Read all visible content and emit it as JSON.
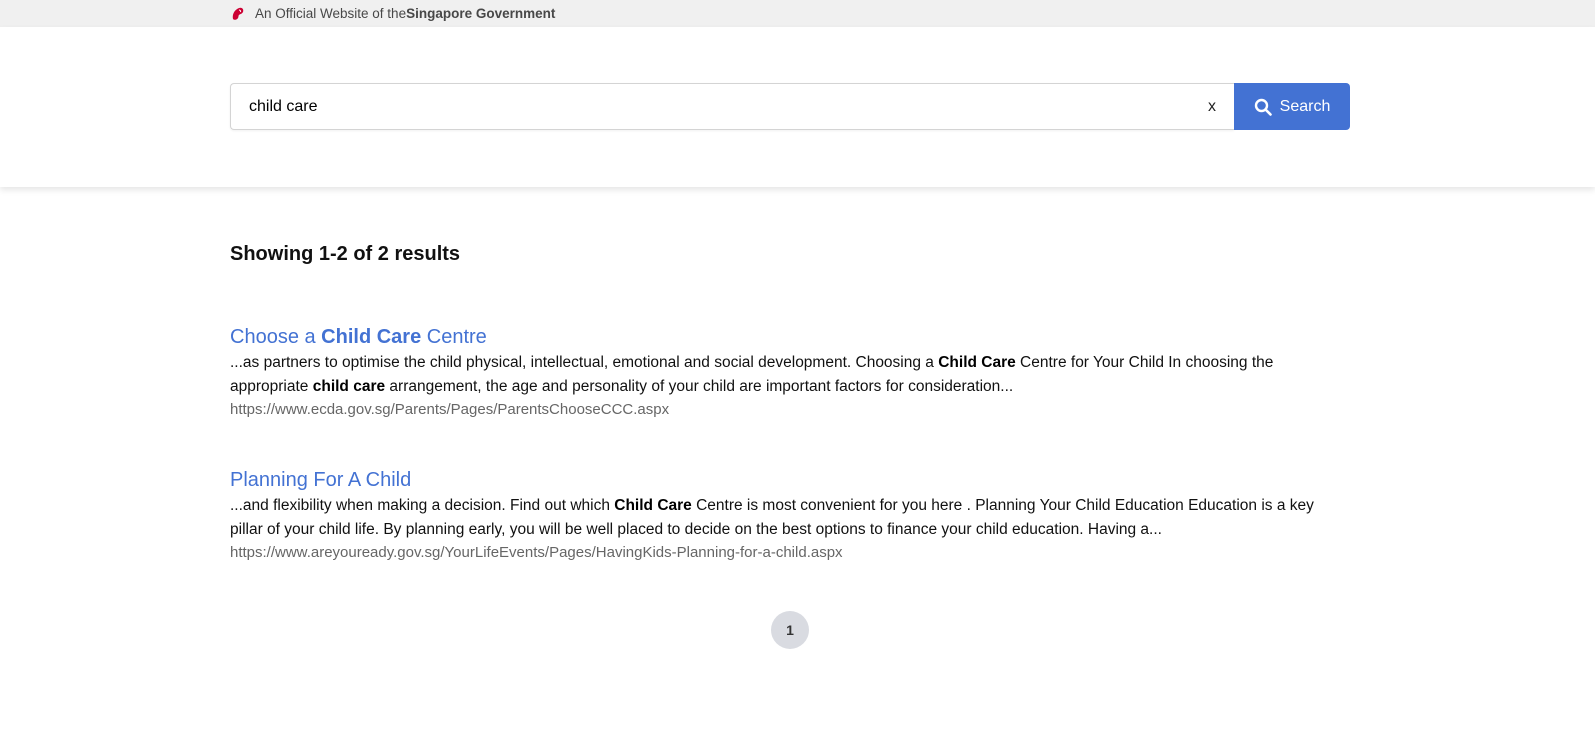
{
  "masthead": {
    "prefix": "An Official Website of the ",
    "emphasis": "Singapore Government",
    "icon": "singapore-lion-icon",
    "icon_color": "#cc0033"
  },
  "search": {
    "value": "child care",
    "clear_label": "x",
    "button_label": "Search",
    "button_color": "#4372d3"
  },
  "results_summary": "Showing 1-2 of 2 results",
  "results": [
    {
      "title_parts": [
        {
          "text": "Choose a ",
          "bold": false
        },
        {
          "text": "Child Care",
          "bold": true
        },
        {
          "text": " Centre",
          "bold": false
        }
      ],
      "snippet_parts": [
        {
          "text": "...as partners to optimise the child physical, intellectual, emotional and social development. Choosing a ",
          "bold": false
        },
        {
          "text": "Child Care",
          "bold": true
        },
        {
          "text": " Centre for Your Child In choosing the appropriate ",
          "bold": false
        },
        {
          "text": "child care",
          "bold": true
        },
        {
          "text": " arrangement, the age and personality of your child are important factors for consideration...",
          "bold": false
        }
      ],
      "url": "https://www.ecda.gov.sg/Parents/Pages/ParentsChooseCCC.aspx"
    },
    {
      "title_parts": [
        {
          "text": "Planning For A Child",
          "bold": false
        }
      ],
      "snippet_parts": [
        {
          "text": "...and flexibility when making a decision. Find out which ",
          "bold": false
        },
        {
          "text": "Child Care",
          "bold": true
        },
        {
          "text": " Centre is most convenient for you here . Planning Your Child Education Education is a key pillar of your child life. By planning early, you will be well placed to decide on the best options to finance your child education. Having a...",
          "bold": false
        }
      ],
      "url": "https://www.areyouready.gov.sg/YourLifeEvents/Pages/HavingKids-Planning-for-a-child.aspx"
    }
  ],
  "pagination": {
    "pages": [
      "1"
    ],
    "current": "1"
  }
}
